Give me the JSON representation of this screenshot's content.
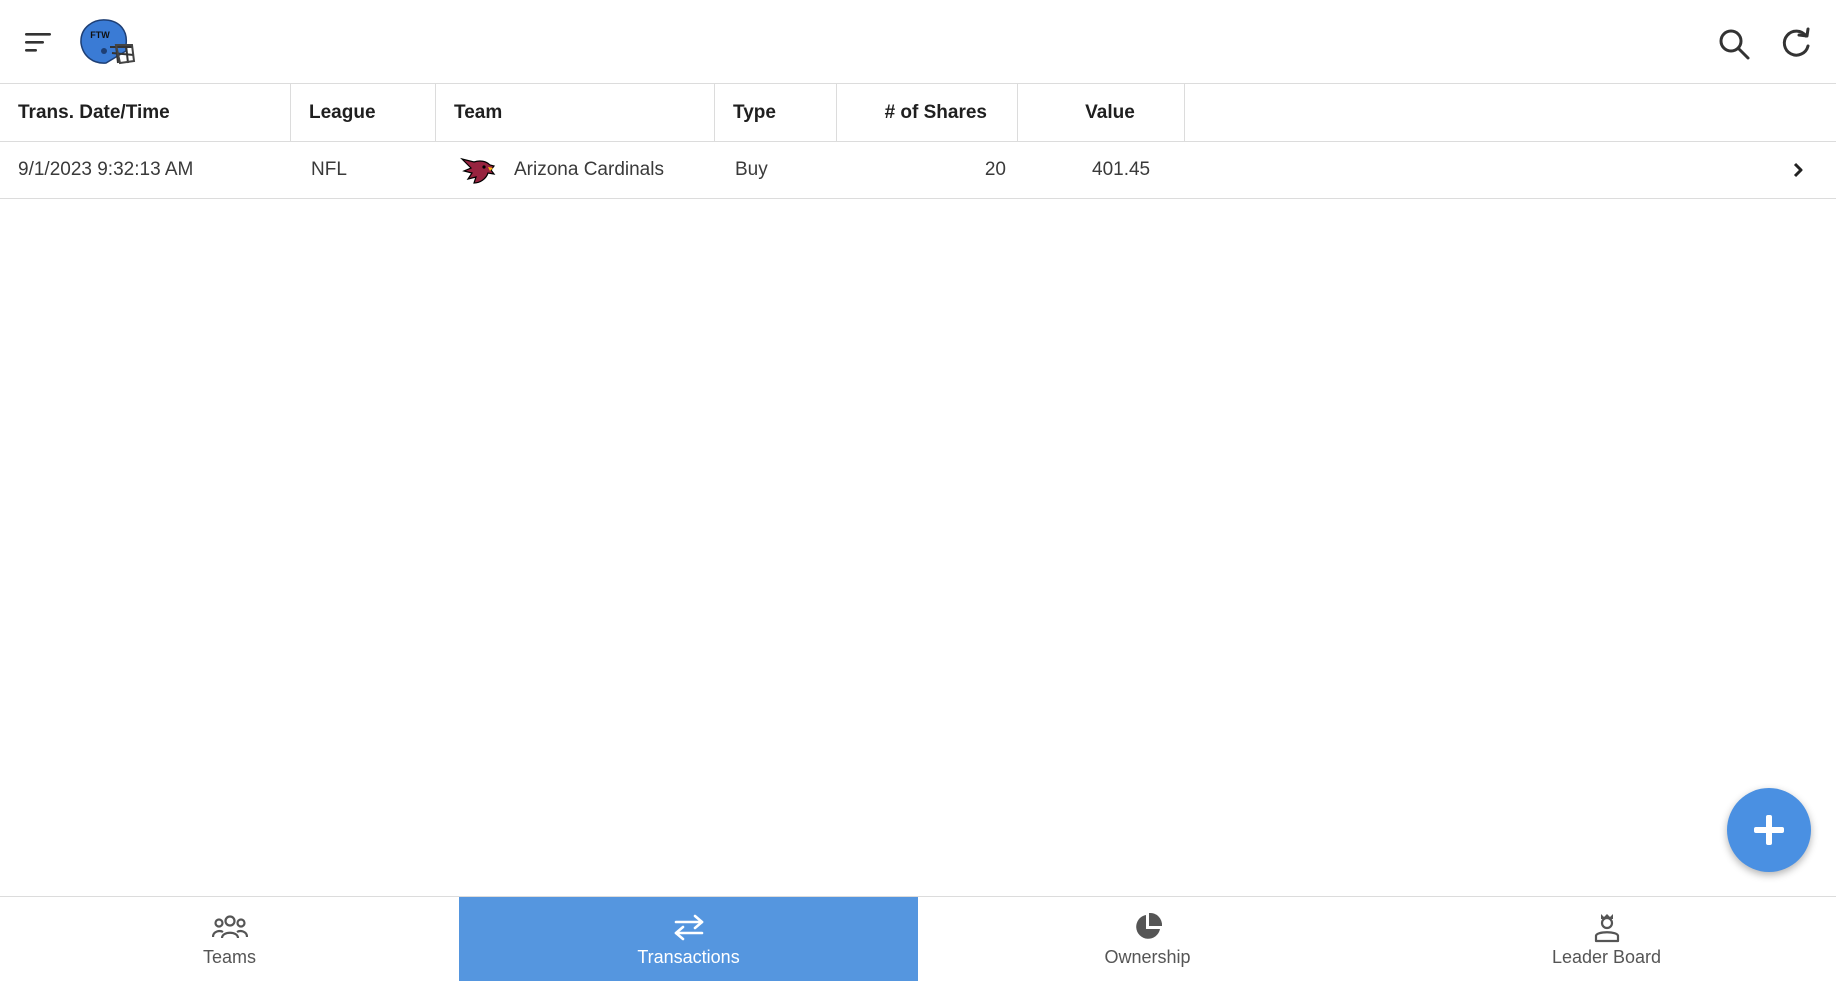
{
  "header": {
    "menu_icon": "sort-menu-icon",
    "logo_text": "FTW",
    "actions": [
      {
        "name": "search",
        "icon": "search-icon"
      },
      {
        "name": "refresh",
        "icon": "refresh-icon"
      }
    ]
  },
  "table": {
    "columns": [
      "Trans. Date/Time",
      "League",
      "Team",
      "Type",
      "# of Shares",
      "Value"
    ],
    "rows": [
      {
        "date_time": "9/1/2023 9:32:13 AM",
        "league": "NFL",
        "team": "Arizona Cardinals",
        "team_icon": "cardinals-logo-icon",
        "type": "Buy",
        "shares": "20",
        "value": "401.45"
      }
    ]
  },
  "fab": {
    "icon": "plus-icon"
  },
  "bottom_nav": {
    "items": [
      {
        "label": "Teams",
        "icon": "teams-icon",
        "active": false
      },
      {
        "label": "Transactions",
        "icon": "swap-arrows-icon",
        "active": true
      },
      {
        "label": "Ownership",
        "icon": "pie-chart-icon",
        "active": false
      },
      {
        "label": "Leader Board",
        "icon": "leader-icon",
        "active": false
      }
    ]
  },
  "colors": {
    "accent": "#5596df",
    "fab": "#4a90e2",
    "helmet": "#3a7bd5"
  }
}
